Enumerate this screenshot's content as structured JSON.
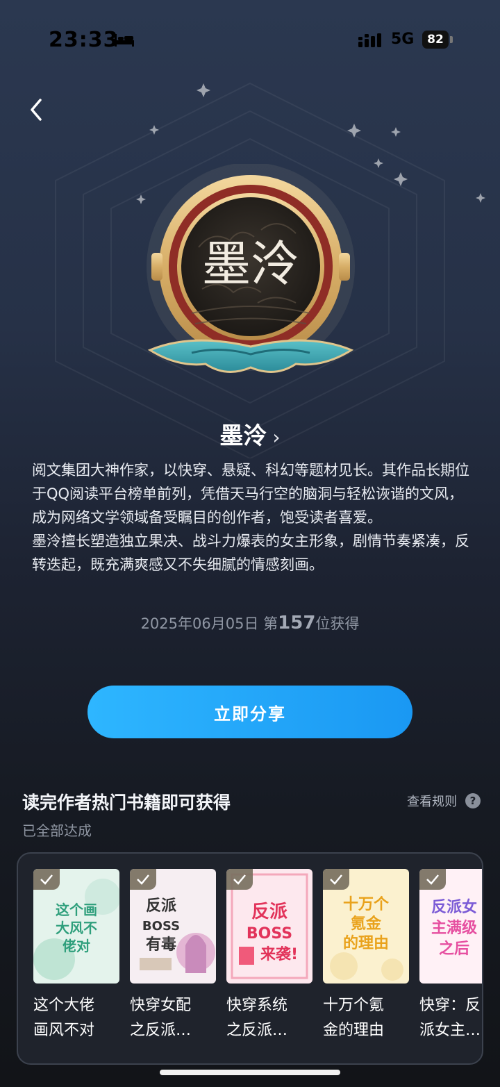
{
  "status_bar": {
    "time": "23:33",
    "network": "5G",
    "battery": "82"
  },
  "author": {
    "name": "墨泠",
    "description": [
      "阅文集团大神作家，以快穿、悬疑、科幻等题材见长。其作品长期位于QQ阅读平台榜单前列，凭借天马行空的脑洞与轻松诙谐的文风，成为网络文学领域备受瞩目的创作者，饱受读者喜爱。",
      "墨泠擅长塑造独立果决、战斗力爆表的女主形象，剧情节奏紧凑，反转迭起，既充满爽感又不失细腻的情感刻画。"
    ],
    "award_date": "2025年06月05日",
    "award_prefix": "第",
    "award_rank": "157",
    "award_suffix": "位获得",
    "medal_text": "墨泠"
  },
  "share_button": "立即分享",
  "section": {
    "title": "读完作者热门书籍即可获得",
    "rules": "查看规则",
    "help": "?",
    "status": "已全部达成"
  },
  "books": [
    {
      "line1": "这个大佬",
      "line2": "画风不对",
      "cover_text": "这个大佬画风不对",
      "color": "#2f9f7c",
      "bg": "#e4f3ec"
    },
    {
      "line1": "快穿女配",
      "line2": "之反派…",
      "cover_text": "反派BOSS有毒",
      "color": "#333333",
      "bg": "#f6eef2"
    },
    {
      "line1": "快穿系统",
      "line2": "之反派…",
      "cover_text": "反派BOSS来袭!",
      "color": "#e2335a",
      "bg": "#fde8ee"
    },
    {
      "line1": "十万个氪",
      "line2": "金的理由",
      "cover_text": "十万个氪金的理由",
      "color": "#e9a21b",
      "bg": "#fbf1cf"
    },
    {
      "line1": "快穿：反",
      "line2": "派女主…",
      "cover_text": "反派女主满级之后",
      "color": "#e64fa0",
      "bg": "#fff1f6"
    }
  ],
  "colors": {
    "accent": "#1a98f3",
    "gold": "#d9b26a"
  }
}
